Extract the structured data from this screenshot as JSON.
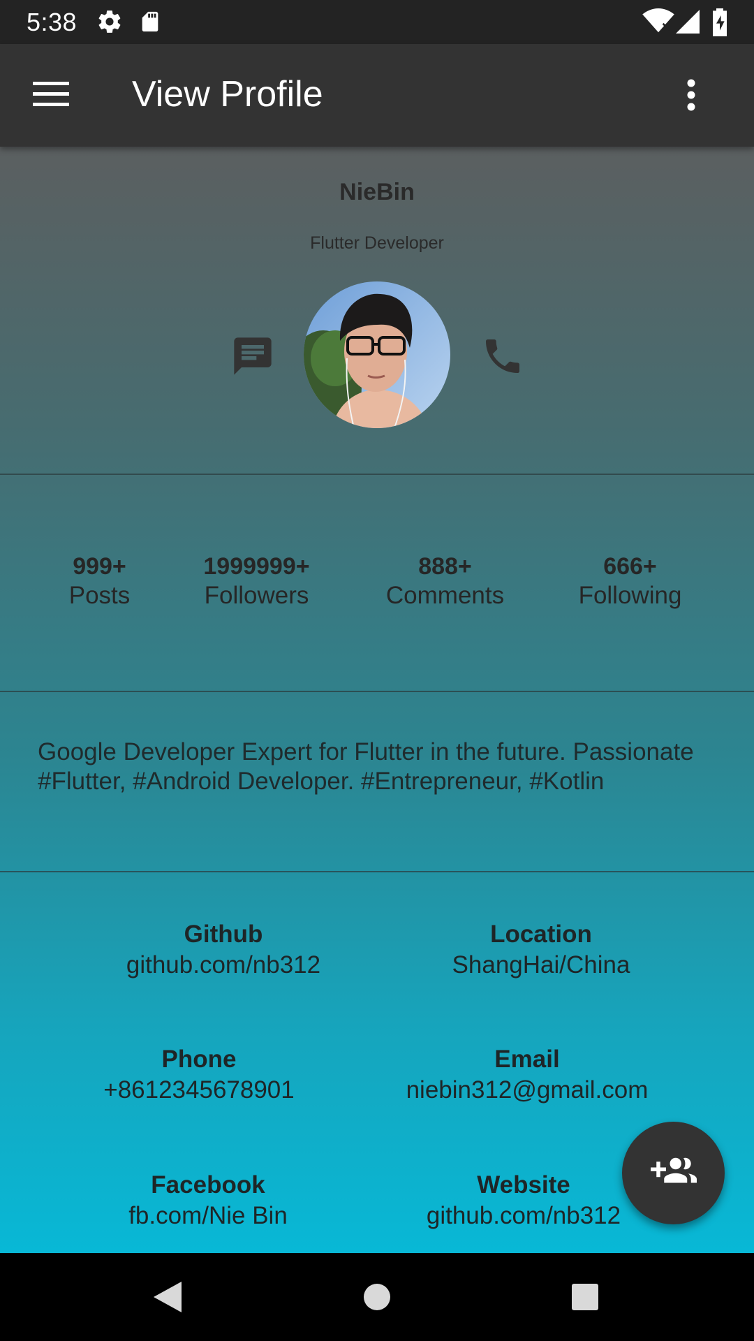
{
  "status_bar": {
    "time": "5:38",
    "icons": [
      "settings-icon",
      "sd-card-icon",
      "wifi-icon",
      "signal-icon",
      "battery-charging-icon"
    ]
  },
  "app_bar": {
    "title": "View Profile",
    "menu_icon": "hamburger-menu-icon",
    "overflow_icon": "more-vert-icon"
  },
  "profile": {
    "name": "NieBin",
    "role": "Flutter Developer",
    "message_icon": "chat-icon",
    "call_icon": "phone-icon"
  },
  "stats": [
    {
      "value": "999+",
      "label": "Posts"
    },
    {
      "value": "1999999+",
      "label": "Followers"
    },
    {
      "value": "888+",
      "label": "Comments"
    },
    {
      "value": "666+",
      "label": "Following"
    }
  ],
  "bio": "Google Developer Expert for Flutter in the future. Passionate #Flutter, #Android Developer. #Entrepreneur, #Kotlin",
  "details": [
    {
      "key": "Github",
      "value": "github.com/nb312"
    },
    {
      "key": "Location",
      "value": "ShangHai/China"
    },
    {
      "key": "Phone",
      "value": "+8612345678901"
    },
    {
      "key": "Email",
      "value": "niebin312@gmail.com"
    },
    {
      "key": "Facebook",
      "value": "fb.com/Nie Bin"
    },
    {
      "key": "Website",
      "value": "github.com/nb312"
    }
  ],
  "fab": {
    "icon": "group-add-icon"
  },
  "colors": {
    "status_bar": "#232323",
    "app_bar": "#333333",
    "gradient_top": "#5b5f60",
    "gradient_bottom": "#08b8d6",
    "fab": "#333333"
  }
}
